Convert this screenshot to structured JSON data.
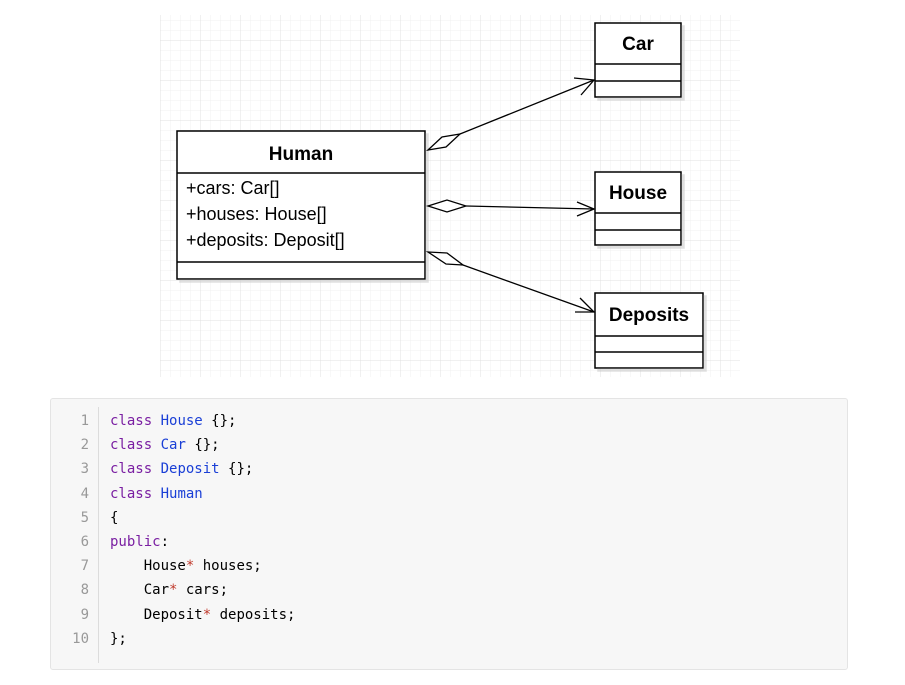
{
  "diagram": {
    "classes": {
      "human": {
        "name": "Human",
        "attributes": [
          "+cars: Car[]",
          "+houses: House[]",
          "+deposits: Deposit[]"
        ]
      },
      "car": {
        "name": "Car"
      },
      "house": {
        "name": "House"
      },
      "deposits": {
        "name": "Deposits"
      }
    }
  },
  "code": {
    "line_numbers": [
      "1",
      "2",
      "3",
      "4",
      "5",
      "6",
      "7",
      "8",
      "9",
      "10"
    ],
    "lines": [
      [
        {
          "t": "class",
          "c": "kw"
        },
        {
          "t": " ",
          "c": ""
        },
        {
          "t": "House",
          "c": "ty"
        },
        {
          "t": " {};",
          "c": ""
        }
      ],
      [
        {
          "t": "class",
          "c": "kw"
        },
        {
          "t": " ",
          "c": ""
        },
        {
          "t": "Car",
          "c": "ty"
        },
        {
          "t": " {};",
          "c": ""
        }
      ],
      [
        {
          "t": "class",
          "c": "kw"
        },
        {
          "t": " ",
          "c": ""
        },
        {
          "t": "Deposit",
          "c": "ty"
        },
        {
          "t": " {};",
          "c": ""
        }
      ],
      [
        {
          "t": "class",
          "c": "kw"
        },
        {
          "t": " ",
          "c": ""
        },
        {
          "t": "Human",
          "c": "ty"
        }
      ],
      [
        {
          "t": "{",
          "c": ""
        }
      ],
      [
        {
          "t": "public",
          "c": "kw"
        },
        {
          "t": ":",
          "c": ""
        }
      ],
      [
        {
          "t": "    House",
          "c": ""
        },
        {
          "t": "*",
          "c": "op"
        },
        {
          "t": " houses;",
          "c": ""
        }
      ],
      [
        {
          "t": "    Car",
          "c": ""
        },
        {
          "t": "*",
          "c": "op"
        },
        {
          "t": " cars;",
          "c": ""
        }
      ],
      [
        {
          "t": "    Deposit",
          "c": ""
        },
        {
          "t": "*",
          "c": "op"
        },
        {
          "t": " deposits;",
          "c": ""
        }
      ],
      [
        {
          "t": "};",
          "c": ""
        }
      ]
    ]
  },
  "colors": {
    "keyword": "#7a1fa2",
    "type": "#1a3fd6",
    "pointer": "#c0392b",
    "grid": "#e3e3e3"
  }
}
